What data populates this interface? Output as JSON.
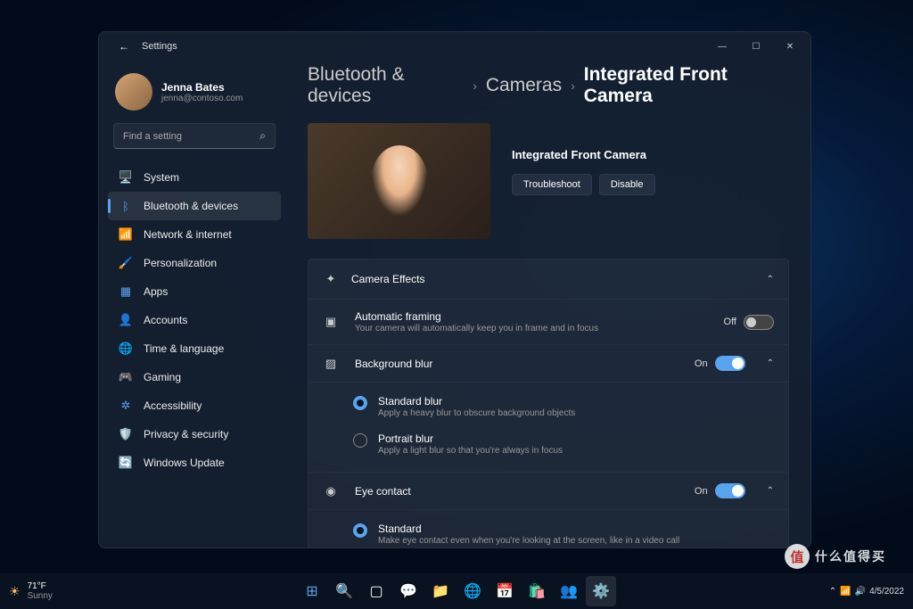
{
  "window": {
    "title": "Settings",
    "controls": {
      "min": "—",
      "max": "☐",
      "close": "✕"
    }
  },
  "profile": {
    "name": "Jenna Bates",
    "email": "jenna@contoso.com"
  },
  "search": {
    "placeholder": "Find a setting"
  },
  "nav": [
    {
      "icon": "🖥️",
      "label": "System",
      "color": "#5aa3ee"
    },
    {
      "icon": "ᛒ",
      "label": "Bluetooth & devices",
      "color": "#5aa3ee",
      "active": true
    },
    {
      "icon": "📶",
      "label": "Network & internet",
      "color": "#5aa3ee"
    },
    {
      "icon": "🖌️",
      "label": "Personalization",
      "color": "#d68a2a"
    },
    {
      "icon": "▦",
      "label": "Apps",
      "color": "#5aa3ee"
    },
    {
      "icon": "👤",
      "label": "Accounts",
      "color": "#5aa3ee"
    },
    {
      "icon": "🌐",
      "label": "Time & language",
      "color": "#5aa3ee"
    },
    {
      "icon": "🎮",
      "label": "Gaming",
      "color": "#ccc"
    },
    {
      "icon": "✲",
      "label": "Accessibility",
      "color": "#5aa3ee"
    },
    {
      "icon": "🛡️",
      "label": "Privacy & security",
      "color": "#888"
    },
    {
      "icon": "🔄",
      "label": "Windows Update",
      "color": "#2a9ed8"
    }
  ],
  "breadcrumb": [
    {
      "label": "Bluetooth & devices"
    },
    {
      "label": "Cameras"
    },
    {
      "label": "Integrated Front Camera",
      "current": true
    }
  ],
  "preview": {
    "title": "Integrated Front Camera",
    "troubleshoot": "Troubleshoot",
    "disable": "Disable"
  },
  "effects": {
    "header": "Camera Effects",
    "framing": {
      "title": "Automatic framing",
      "desc": "Your camera will automatically keep you in frame and in focus",
      "state": "Off"
    },
    "blur": {
      "title": "Background blur",
      "state": "On",
      "options": [
        {
          "title": "Standard blur",
          "desc": "Apply a heavy blur to obscure background objects",
          "checked": true
        },
        {
          "title": "Portrait blur",
          "desc": "Apply a light blur so that you're always in focus",
          "checked": false
        }
      ]
    },
    "eye": {
      "title": "Eye contact",
      "state": "On",
      "options": [
        {
          "title": "Standard",
          "desc": "Make eye contact even when you're looking at the screen, like in a video call",
          "checked": true
        }
      ]
    }
  },
  "taskbar": {
    "weather": {
      "temp": "71°F",
      "cond": "Sunny"
    },
    "date": "4/5/2022"
  },
  "watermark": {
    "badge": "值",
    "text": "什么值得买"
  }
}
